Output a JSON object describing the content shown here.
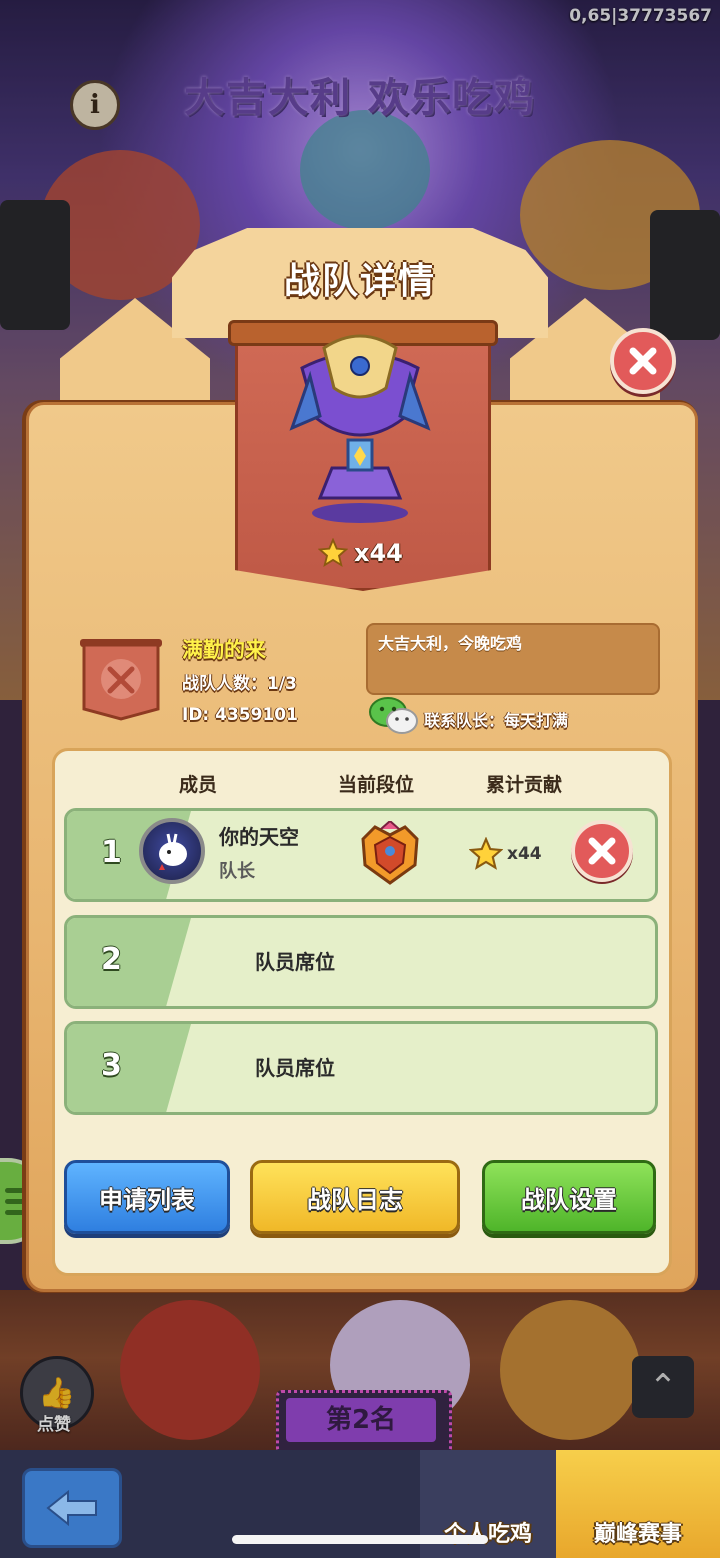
{
  "status": {
    "version": "0,65|37773567"
  },
  "background": {
    "event_banner": "大吉大利 欢乐吃鸡",
    "rank_badge": "第2名",
    "like_label": "点赞",
    "nav": {
      "tab1": "个人吃鸡",
      "tab2": "巅峰赛事"
    }
  },
  "dialog": {
    "title": "战队详情",
    "trophy_stars": "x44",
    "team": {
      "name": "满勤的来",
      "member_count": "战队人数：1/3",
      "id": "ID: 4359101",
      "motto": "大吉大利，今晚吃鸡",
      "contact": "联系队长：每天打满"
    },
    "columns": {
      "member": "成员",
      "rank": "当前段位",
      "contribution": "累计贡献"
    },
    "members": [
      {
        "num": "1",
        "name": "你的天空",
        "role": "队长",
        "contribution": "x44"
      },
      {
        "num": "2",
        "label": "队员席位"
      },
      {
        "num": "3",
        "label": "队员席位"
      }
    ],
    "buttons": {
      "apply_list": "申请列表",
      "team_log": "战队日志",
      "team_settings": "战队设置"
    }
  },
  "colors": {
    "blue": "#2f7fe0",
    "yellow": "#f0b828",
    "green": "#4fb52a",
    "close_red": "#e25a5a"
  }
}
